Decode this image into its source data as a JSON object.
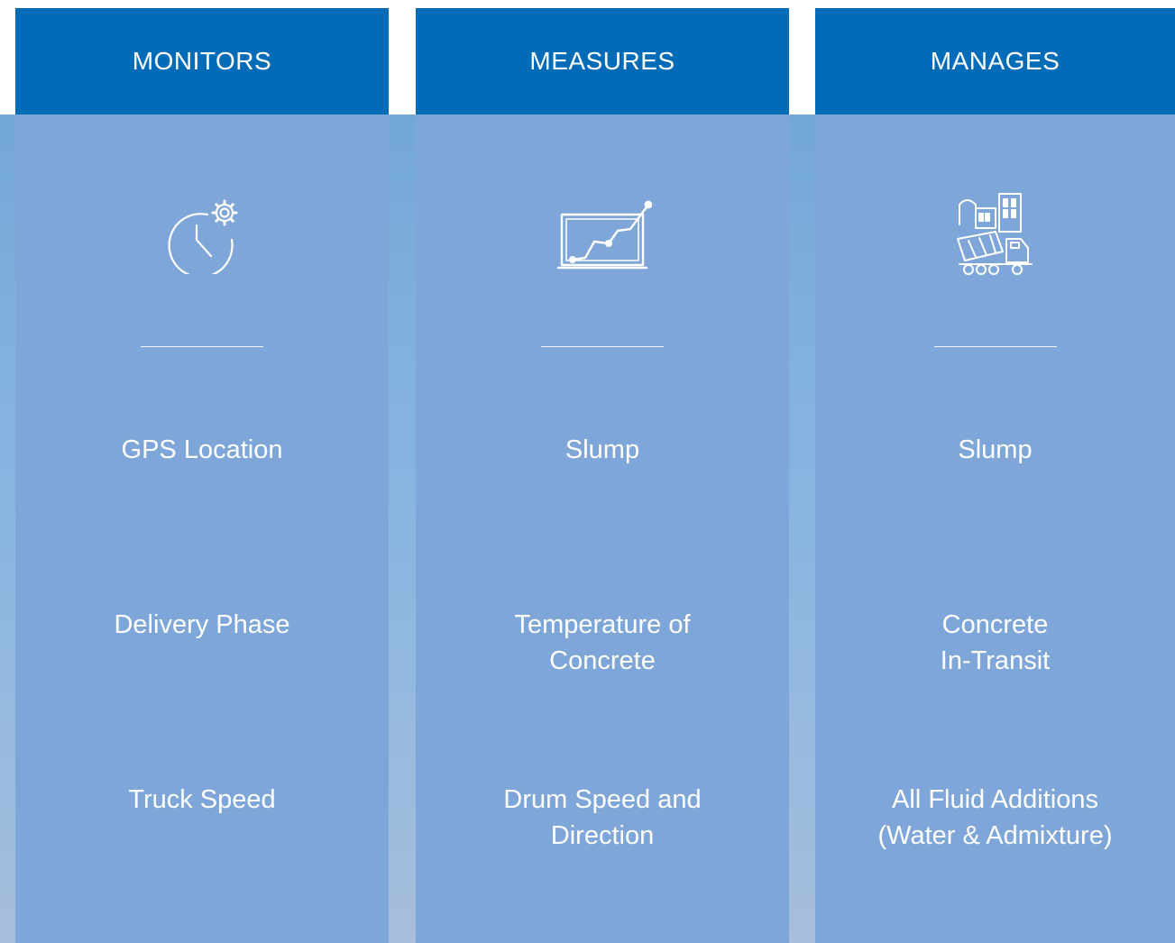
{
  "colors": {
    "header_bg": "#006cb8",
    "column_bg": "#7fa6d8",
    "text": "#ffffff"
  },
  "columns": [
    {
      "title": "MONITORS",
      "icon": "clock-gear-icon",
      "items": [
        "GPS Location",
        "Delivery Phase",
        "Truck Speed"
      ]
    },
    {
      "title": "MEASURES",
      "icon": "line-chart-monitor-icon",
      "items": [
        "Slump",
        "Temperature of\nConcrete",
        "Drum Speed and\nDirection"
      ]
    },
    {
      "title": "MANAGES",
      "icon": "concrete-plant-truck-icon",
      "items": [
        "Slump",
        "Concrete\nIn-Transit",
        "All Fluid Additions\n(Water & Admixture)"
      ]
    }
  ]
}
